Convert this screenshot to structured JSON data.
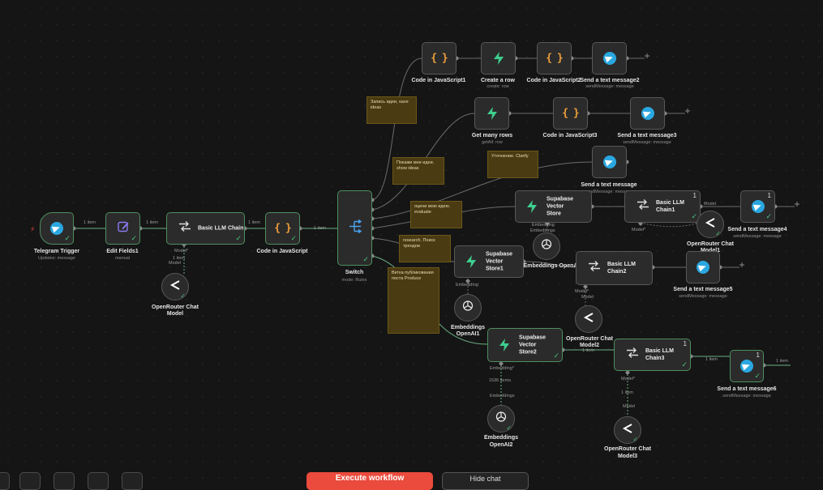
{
  "nodes": {
    "telegram_trigger": {
      "label": "Telegram Trigger",
      "sub": "Updates: message"
    },
    "edit_fields": {
      "label": "Edit Fields1",
      "sub": "manual"
    },
    "basic_llm_chain": {
      "label": "Basic LLM Chain"
    },
    "openrouter_model": {
      "label1": "OpenRouter Chat",
      "label2": "Model"
    },
    "code_js": {
      "label": "Code in JavaScript"
    },
    "switch": {
      "label": "Switch",
      "sub": "mode: Rules"
    },
    "code_js1": {
      "label": "Code in JavaScript1"
    },
    "create_row": {
      "label": "Create a row",
      "sub": "create: row"
    },
    "code_js2": {
      "label": "Code in JavaScript2"
    },
    "send_msg2": {
      "label": "Send a text message2",
      "sub": "sendMessage: message"
    },
    "get_many_rows": {
      "label": "Get many rows",
      "sub": "getAll: row"
    },
    "code_js3": {
      "label": "Code in JavaScript3"
    },
    "send_msg3": {
      "label": "Send a text message3",
      "sub": "sendMessage: message"
    },
    "send_msg": {
      "label": "Send a text message",
      "sub": "sendMessage: message"
    },
    "supabase_store": {
      "label1": "Supabase Vector",
      "label2": "Store"
    },
    "basic_llm_chain1": {
      "label1": "Basic LLM",
      "label2": "Chain1",
      "count": "1"
    },
    "send_msg4": {
      "label": "Send a text message4",
      "sub": "sendMessage: message",
      "count": "1"
    },
    "openrouter_model1": {
      "label1": "OpenRouter Chat",
      "label2": "Model1"
    },
    "embeddings_openai": {
      "label": "Embeddings OpenAI"
    },
    "supabase_store1": {
      "label1": "Supabase Vector",
      "label2": "Store1"
    },
    "basic_llm_chain2": {
      "label1": "Basic LLM",
      "label2": "Chain2"
    },
    "send_msg5": {
      "label": "Send a text message5",
      "sub": "sendMessage: message"
    },
    "openrouter_model2": {
      "label1": "OpenRouter Chat",
      "label2": "Model2"
    },
    "embeddings_openai1": {
      "label1": "Embeddings",
      "label2": "OpenAI1"
    },
    "supabase_store2": {
      "label1": "Supabase Vector",
      "label2": "Store2"
    },
    "basic_llm_chain3": {
      "label1": "Basic LLM",
      "label2": "Chain3",
      "count": "1"
    },
    "send_msg6": {
      "label": "Send a text message6",
      "sub": "sendMessage: message",
      "count": "1"
    },
    "openrouter_model3": {
      "label1": "OpenRouter Chat",
      "label2": "Model3"
    },
    "embeddings_openai2": {
      "label1": "Embeddings",
      "label2": "OpenAI2"
    }
  },
  "stickies": {
    "save_ideas": "Запись идеи, save ideas",
    "show_ideas": "Покажи мне идеи. show ideas",
    "clarify": "Уточнение. Clarify",
    "evaluate": "оцени мою идею. evaluate",
    "trends": "research. Поиск трендов",
    "produce": "Ветка публикования поста Produce"
  },
  "wire_labels": {
    "one_item": "1 item",
    "items_1536": "1536 items",
    "model": "Model",
    "model_req": "Model*",
    "embedding": "Embedding",
    "embedding_req": "Embedding*",
    "embeddings": "Embeddings"
  },
  "toolbar": {
    "run_label": "Execute workflow",
    "secondary_label": "Hide chat"
  }
}
